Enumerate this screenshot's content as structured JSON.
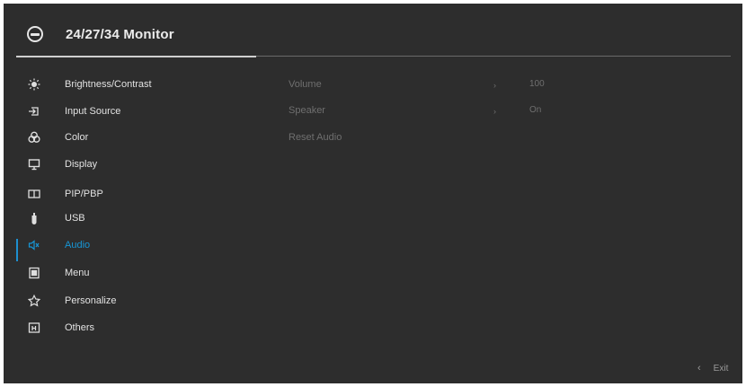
{
  "header": {
    "title": "24/27/34 Monitor",
    "logo_icon": "dell-logo-icon"
  },
  "menu": {
    "items": [
      {
        "label": "Brightness/Contrast",
        "icon": "brightness-icon"
      },
      {
        "label": "Input Source",
        "icon": "input-source-icon"
      },
      {
        "label": "Color",
        "icon": "color-icon"
      },
      {
        "label": "Display",
        "icon": "display-icon"
      },
      {
        "label": "PIP/PBP",
        "icon": "pip-pbp-icon"
      },
      {
        "label": "USB",
        "icon": "usb-icon"
      },
      {
        "label": "Audio",
        "icon": "audio-icon",
        "selected": true
      },
      {
        "label": "Menu",
        "icon": "menu-icon"
      },
      {
        "label": "Personalize",
        "icon": "personalize-icon"
      },
      {
        "label": "Others",
        "icon": "others-icon"
      }
    ]
  },
  "audio_panel": {
    "volume": {
      "label": "Volume",
      "value": "100",
      "arrow": "›"
    },
    "speaker": {
      "label": "Speaker",
      "value": "On",
      "arrow": "›"
    },
    "reset": {
      "label": "Reset Audio"
    }
  },
  "footer": {
    "exit_label": "Exit",
    "exit_icon": "‹"
  },
  "colors": {
    "background": "#2d2d2d",
    "accent": "#1796d6",
    "text": "#e2e2e2",
    "dim_text": "#6f6f6f"
  }
}
